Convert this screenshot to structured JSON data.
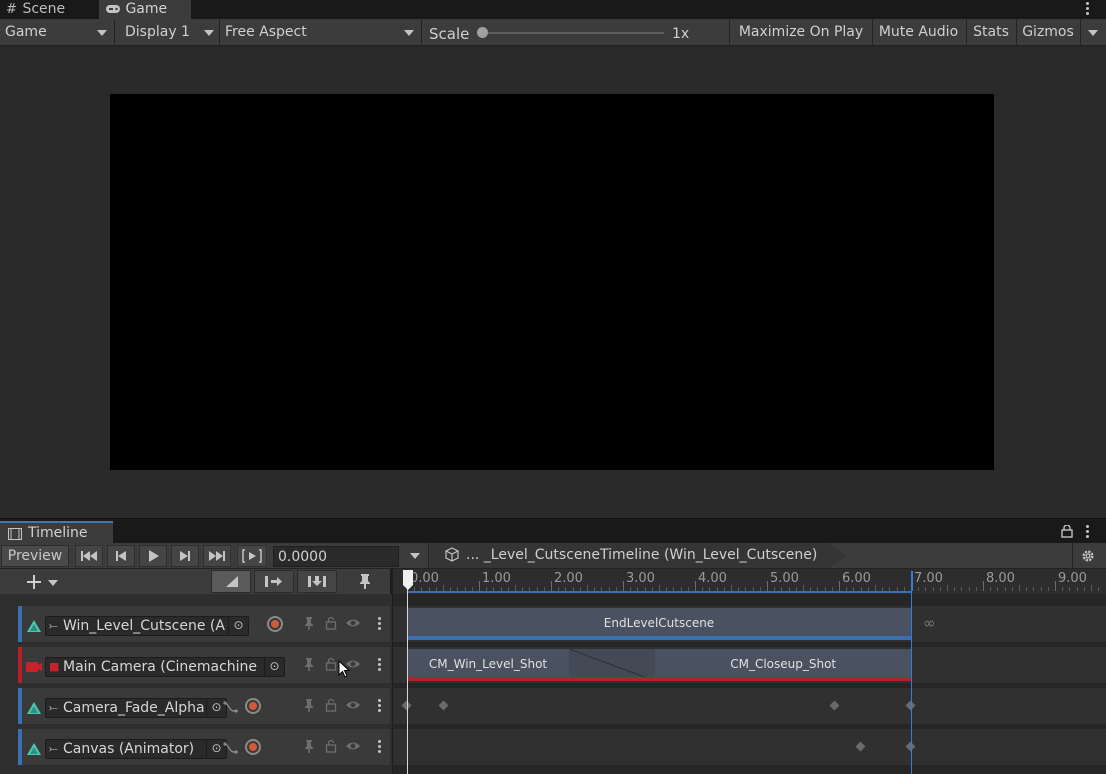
{
  "tabs": [
    {
      "label": "Scene",
      "icon": "grid-icon"
    },
    {
      "label": "Game",
      "icon": "gamepad-icon"
    }
  ],
  "game_toolbar": {
    "view_mode": "Game",
    "display": "Display 1",
    "aspect": "Free Aspect",
    "scale_label": "Scale",
    "scale_value": "1x",
    "scale_fraction": 0.0,
    "maximize_on_play": "Maximize On Play",
    "mute_audio": "Mute Audio",
    "stats": "Stats",
    "gizmos": "Gizmos"
  },
  "timeline": {
    "tab_label": "Timeline",
    "preview_label": "Preview",
    "current_time": "0.0000",
    "breadcrumb": "... _Level_CutsceneTimeline (Win_Level_Cutscene)",
    "ruler_labels": [
      "0.00",
      "1.00",
      "2.00",
      "3.00",
      "4.00",
      "5.00",
      "6.00",
      "7.00",
      "8.00",
      "9.00"
    ],
    "end_time": 7.0,
    "tracks": [
      {
        "name": "Win_Level_Cutscene (A",
        "color": "#3a6fb0",
        "type": "animation",
        "clips": [
          {
            "label": "EndLevelCutscene",
            "start": 0.0,
            "end": 7.0
          }
        ]
      },
      {
        "name": "Main Camera (Cinemachine",
        "color": "#b5202a",
        "type": "cinemachine",
        "clips": [
          {
            "label": "CM_Win_Level_Shot",
            "start": 0.0,
            "end": 2.25
          },
          {
            "label": "CM_Closeup_Shot",
            "start": 3.45,
            "end": 7.0
          }
        ]
      },
      {
        "name": "Camera_Fade_Alpha",
        "color": "#3a6fb0",
        "type": "animation",
        "keyframes": [
          0.0,
          0.52,
          5.95,
          7.0
        ]
      },
      {
        "name": "Canvas (Animator)",
        "color": "#3a6fb0",
        "type": "animation",
        "keyframes": [
          6.3,
          7.0
        ]
      }
    ]
  }
}
